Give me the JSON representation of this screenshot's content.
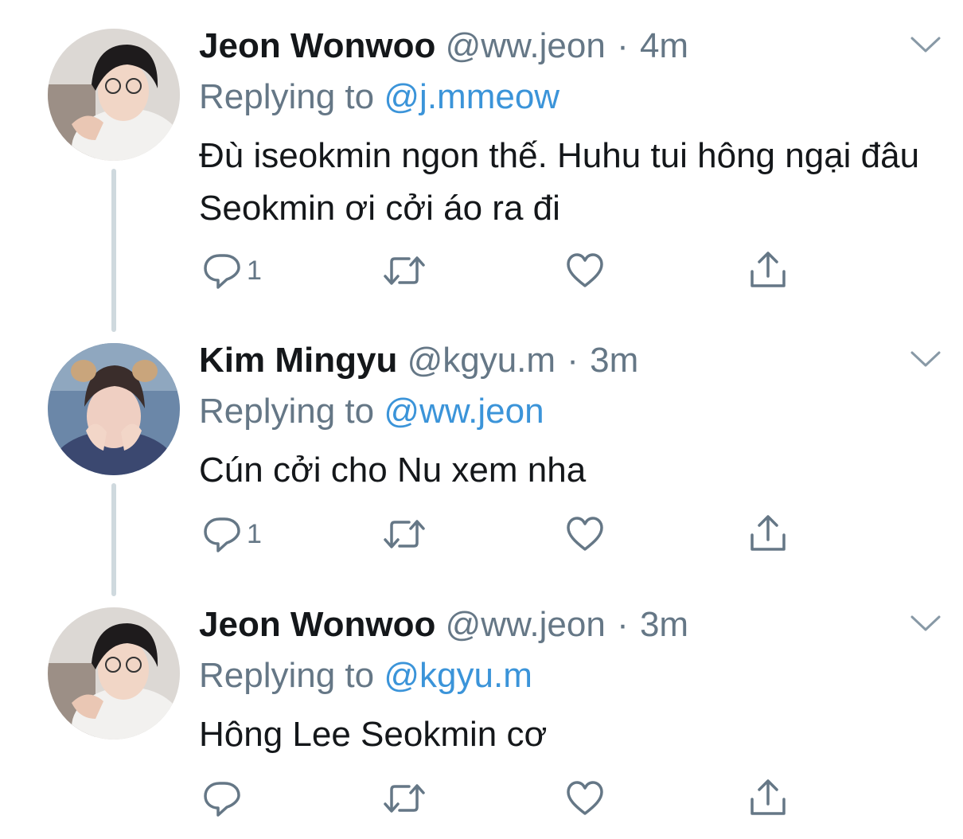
{
  "colors": {
    "name": "#14171a",
    "secondary": "#657786",
    "mention": "#3b94d9",
    "thread_line": "#cfd9de",
    "icon": "#657786"
  },
  "tweets": [
    {
      "name": "Jeon Wonwoo",
      "handle": "@ww.jeon",
      "separator": "·",
      "time": "4m",
      "replying_prefix": "Replying to",
      "replying_to": "@j.mmeow",
      "text": "Đù iseokmin ngon thế. Huhu tui hông ngại đâu Seokmin ơi cởi áo ra đi",
      "reply_count": "1",
      "avatar_icon": "avatar-wonwoo"
    },
    {
      "name": "Kim Mingyu",
      "handle": "@kgyu.m",
      "separator": "·",
      "time": "3m",
      "replying_prefix": "Replying to",
      "replying_to": "@ww.jeon",
      "text": "Cún cởi cho Nu xem nha",
      "reply_count": "1",
      "avatar_icon": "avatar-mingyu"
    },
    {
      "name": "Jeon Wonwoo",
      "handle": "@ww.jeon",
      "separator": "·",
      "time": "3m",
      "replying_prefix": "Replying to",
      "replying_to": "@kgyu.m",
      "text": "Hông Lee Seokmin cơ",
      "reply_count": "",
      "avatar_icon": "avatar-wonwoo"
    }
  ],
  "icons": {
    "more": "chevron-down-icon",
    "reply": "reply-icon",
    "retweet": "retweet-icon",
    "like": "heart-icon",
    "share": "share-icon"
  }
}
